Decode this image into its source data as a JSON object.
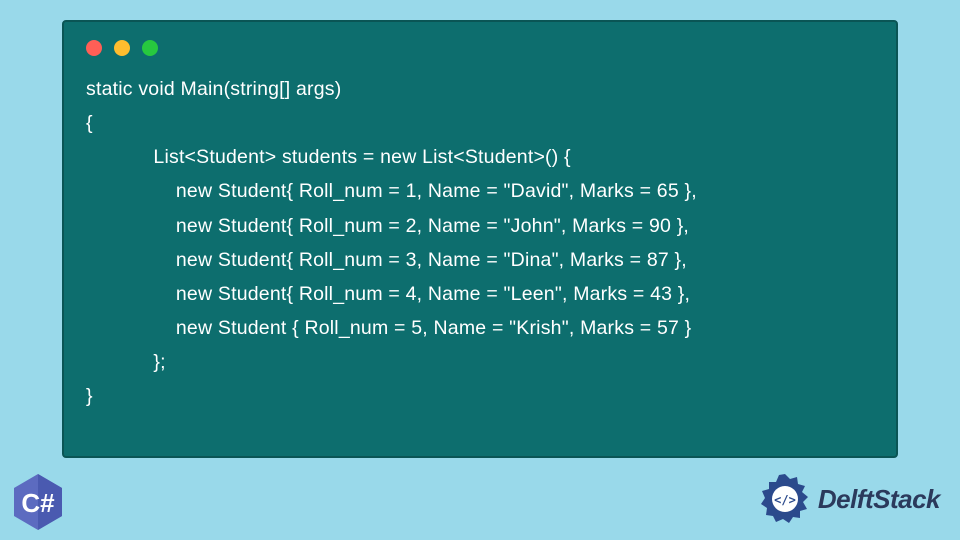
{
  "code": {
    "lines": [
      "static void Main(string[] args)",
      "{",
      "            List<Student> students = new List<Student>() {",
      "                new Student{ Roll_num = 1, Name = \"David\", Marks = 65 },",
      "                new Student{ Roll_num = 2, Name = \"John\", Marks = 90 },",
      "                new Student{ Roll_num = 3, Name = \"Dina\", Marks = 87 },",
      "                new Student{ Roll_num = 4, Name = \"Leen\", Marks = 43 },",
      "                new Student { Roll_num = 5, Name = \"Krish\", Marks = 57 }",
      "            };",
      "}"
    ]
  },
  "badge": {
    "language": "C#"
  },
  "brand": {
    "name": "DelftStack"
  },
  "colors": {
    "background": "#99d9ea",
    "windowBg": "#0d6e6e",
    "csharpBadge": "#5c6bc0",
    "brandText": "#2b3a5c"
  }
}
